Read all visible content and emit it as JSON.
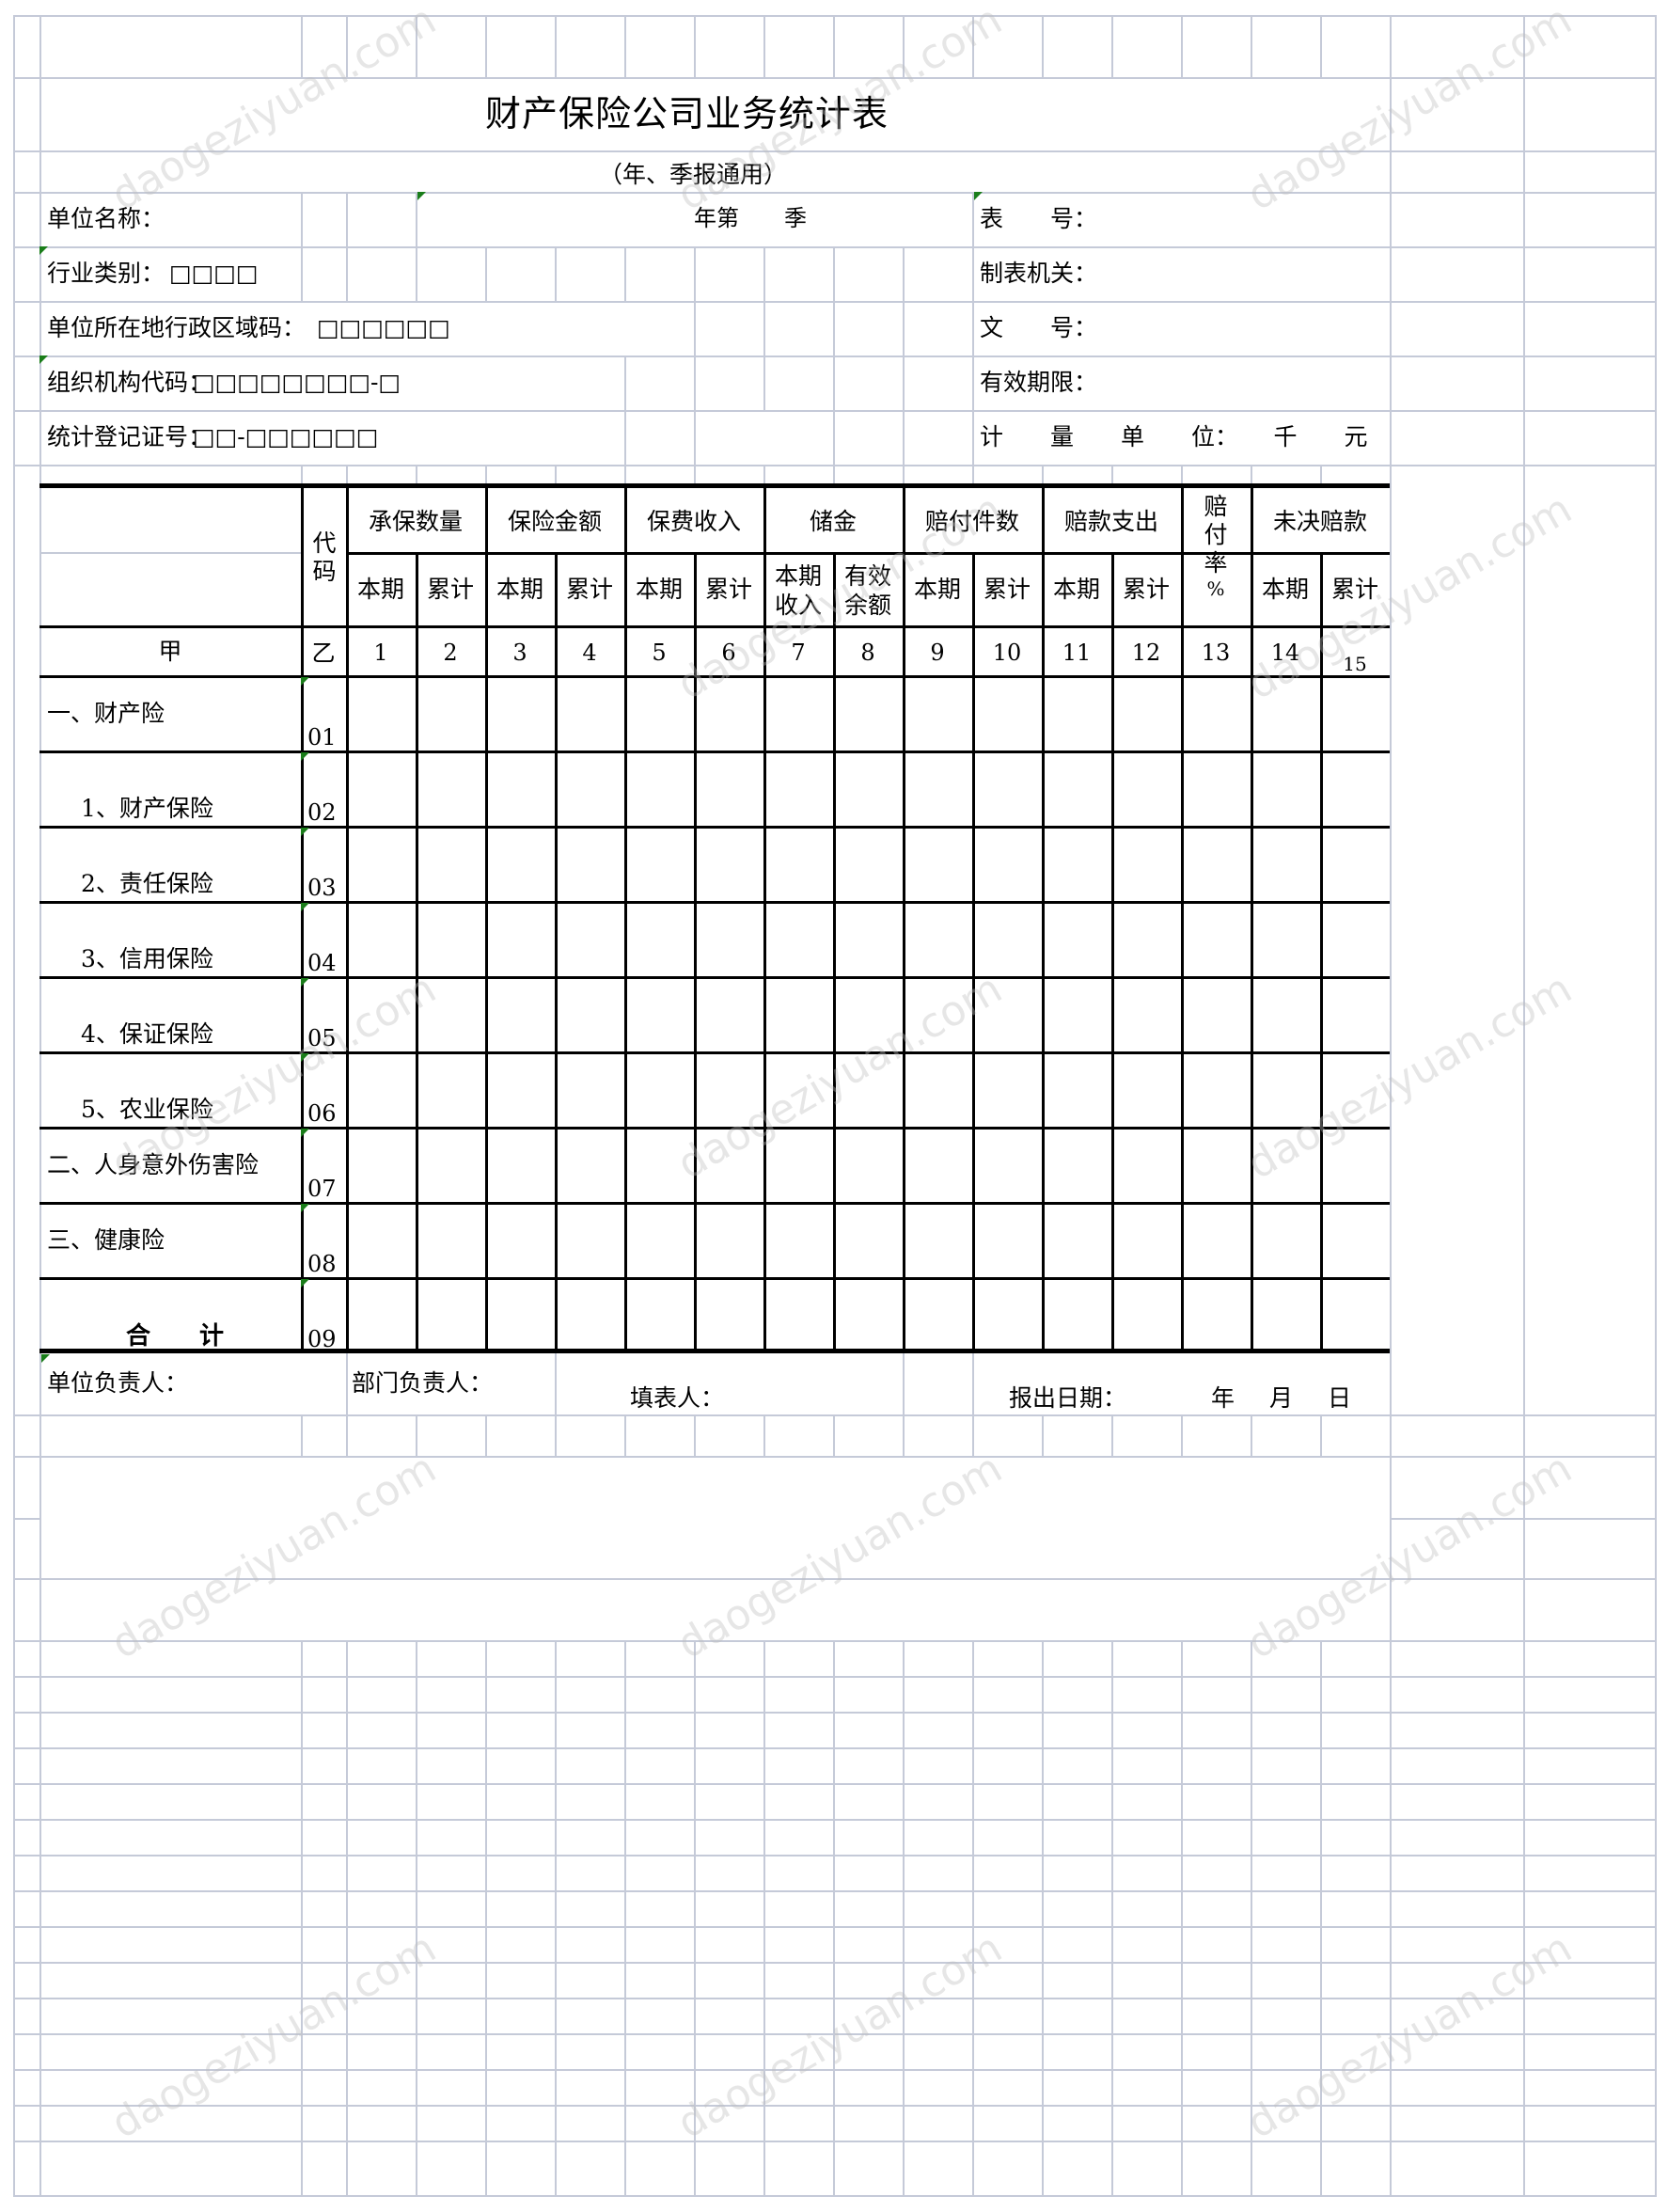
{
  "title": "财产保险公司业务统计表",
  "subtitle": "（年、季报通用）",
  "info_left": [
    {
      "label": "单位名称：",
      "value": ""
    },
    {
      "label": "行业类别：",
      "value": "□□□□"
    },
    {
      "label": "单位所在地行政区域码：",
      "value": "□□□□□□"
    },
    {
      "label": "组织机构代码：",
      "value": "□□□□□□□□-□"
    },
    {
      "label": "统计登记证号：",
      "value": "□□-□□□□□□"
    }
  ],
  "period_label": "年第　　季",
  "info_right": [
    "表　　号：",
    "制表机关：",
    "文　　号：",
    "有效期限：",
    "计　　量　　单　　位：　　千　　元"
  ],
  "table": {
    "code_header": "代码",
    "groups": [
      {
        "label": "承保数量",
        "sub": [
          "本期",
          "累计"
        ]
      },
      {
        "label": "保险金额",
        "sub": [
          "本期",
          "累计"
        ]
      },
      {
        "label": "保费收入",
        "sub": [
          "本期",
          "累计"
        ]
      },
      {
        "label": "储金",
        "sub": [
          "本期收入",
          "有效余额"
        ]
      },
      {
        "label": "赔付件数",
        "sub": [
          "本期",
          "累计"
        ]
      },
      {
        "label": "赔款支出",
        "sub": [
          "本期",
          "累计"
        ]
      },
      {
        "label": "赔付率",
        "sub": [
          "%"
        ]
      },
      {
        "label": "未决赔款",
        "sub": [
          "本期",
          "累计"
        ]
      }
    ],
    "index_row": {
      "label": "甲",
      "code": "乙",
      "numbers": [
        "1",
        "2",
        "3",
        "4",
        "5",
        "6",
        "7",
        "8",
        "9",
        "10",
        "11",
        "12",
        "13",
        "14",
        "15"
      ]
    },
    "rows": [
      {
        "label": "一、财产险",
        "code": "01"
      },
      {
        "label": "1、财产保险",
        "code": "02"
      },
      {
        "label": "2、责任保险",
        "code": "03"
      },
      {
        "label": "3、信用保险",
        "code": "04"
      },
      {
        "label": "4、保证保险",
        "code": "05"
      },
      {
        "label": "5、农业保险",
        "code": "06"
      },
      {
        "label": "二、人身意外伤害险",
        "code": "07"
      },
      {
        "label": "三、健康险",
        "code": "08"
      },
      {
        "label": "合　　计",
        "code": "09"
      }
    ]
  },
  "footer": {
    "unit_head": "单位负责人：",
    "dept_head": "部门负责人：",
    "preparer": "填表人：",
    "report_date": "报出日期：",
    "year": "年",
    "month": "月",
    "day": "日"
  },
  "watermark": "daogeziyuan.com",
  "colors": {
    "gridline": "#c5cad8",
    "flag": "#1a7d1a",
    "border": "#000000"
  }
}
